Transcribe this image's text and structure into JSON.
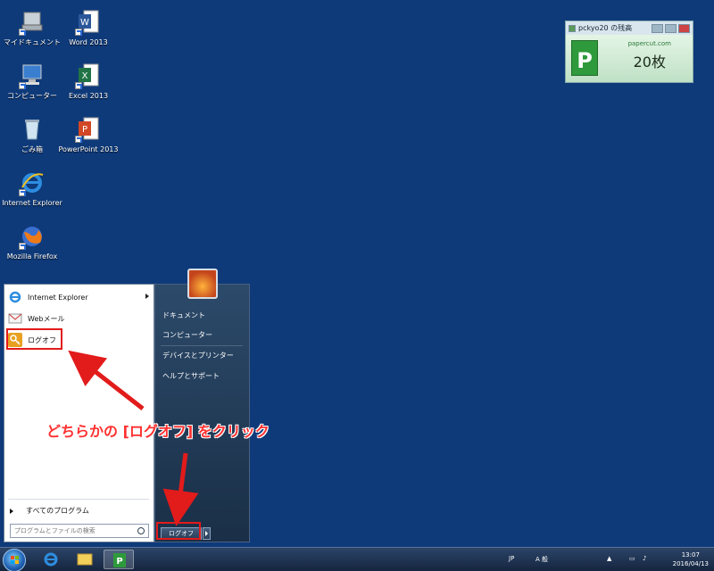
{
  "desktop": {
    "icons": [
      {
        "label": "マイドキュメント"
      },
      {
        "label": "Word 2013"
      },
      {
        "label": "コンピューター"
      },
      {
        "label": "Excel 2013"
      },
      {
        "label": "ごみ箱"
      },
      {
        "label": "PowerPoint 2013"
      },
      {
        "label": "Internet Explorer"
      },
      {
        "label": "Mozilla Firefox"
      }
    ]
  },
  "gadget": {
    "title": "pckyo20 の残高",
    "site": "papercut.com",
    "count": "20枚"
  },
  "start_menu": {
    "left_items": [
      {
        "label": "Internet Explorer"
      },
      {
        "label": "Webメール"
      },
      {
        "label": "ログオフ"
      }
    ],
    "all_programs": "すべてのプログラム",
    "search_placeholder": "プログラムとファイルの検索",
    "right_items": [
      {
        "label": "ドキュメント"
      },
      {
        "label": "コンピューター"
      },
      {
        "label": "デバイスとプリンター"
      },
      {
        "label": "ヘルプとサポート"
      }
    ],
    "logoff_button": "ログオフ"
  },
  "annotation": "どちらかの [ログオフ] をクリック",
  "taskbar": {
    "lang": "JP",
    "ime_mode": "A 般",
    "clock_time": "13:07",
    "clock_date": "2016/04/13"
  },
  "colors": {
    "desktop": "#0e3a7a",
    "highlight": "#e21b1b",
    "annotation": "#ff3030"
  }
}
